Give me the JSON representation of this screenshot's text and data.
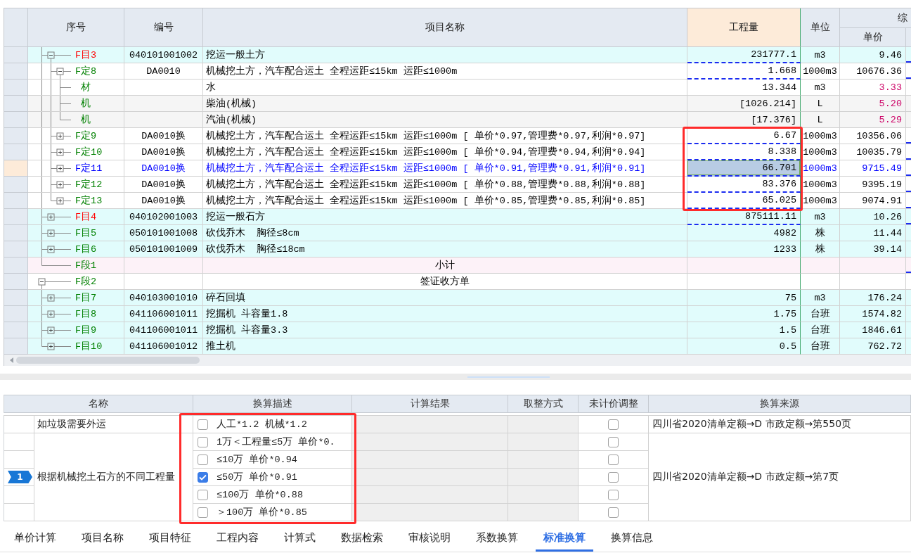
{
  "quota_table": {
    "columns": [
      {
        "label": "序号",
        "selected": false
      },
      {
        "label": "编号",
        "selected": false
      },
      {
        "label": "项目名称",
        "selected": false
      },
      {
        "label": "工程量",
        "selected": true
      },
      {
        "label": "单位",
        "selected": false
      }
    ],
    "column_group": {
      "label": "综",
      "columns": [
        {
          "label": "单价",
          "selected": false
        }
      ]
    },
    "rows": [
      {
        "children": [
          {
            "kind": "item",
            "seq": "F目3",
            "code": "040101001002",
            "name": "挖运一般土方",
            "quantity": "231777.1",
            "unit": "m3",
            "unit_price": "9.46",
            "color": "#ff0000",
            "expanded": true,
            "selected": false,
            "framed": false,
            "quantity_underline": true,
            "column_8_underline": true,
            "children": [
              {
                "kind": "quota",
                "seq": "F定8",
                "code": "DA0010",
                "name": "机械挖土方，汽车配合运土 全程运距≤15km 运距≤1000m",
                "quantity": "1.668",
                "unit": "1000m3",
                "unit_price": "10676.36",
                "color": "#008000",
                "expanded": true,
                "selected": false,
                "framed": false,
                "quantity_underline": true,
                "column_8_underline": true,
                "children": [
                  {
                    "kind": "material",
                    "seq": "材",
                    "name": "水",
                    "quantity": "13.344",
                    "unit": "m3",
                    "unit_price": {
                      "text": "3.33",
                      "color": "#cc0066"
                    },
                    "color": "#008000",
                    "selected": false,
                    "framed": false,
                    "quantity_underline": false,
                    "column_8_underline": false
                  },
                  {
                    "kind": "machinery",
                    "seq": "机",
                    "name": "柴油(机械)",
                    "quantity": "[1026.214]",
                    "unit": "L",
                    "unit_price": {
                      "text": "5.20",
                      "color": "#cc0066"
                    },
                    "color": "#008000",
                    "selected": false,
                    "framed": false,
                    "quantity_underline": false,
                    "column_8_underline": false
                  },
                  {
                    "kind": "machinery",
                    "seq": "机",
                    "name": "汽油(机械)",
                    "quantity": "[17.376]",
                    "unit": "L",
                    "unit_price": {
                      "text": "5.29",
                      "color": "#cc0066"
                    },
                    "color": "#008000",
                    "selected": false,
                    "framed": false,
                    "quantity_underline": false,
                    "column_8_underline": false
                  }
                ]
              },
              {
                "kind": "quota",
                "seq": "F定9",
                "code": "DA0010换",
                "name": "机械挖土方，汽车配合运土 全程运距≤15km 运距≤1000m [ 单价*0.97,管理费*0.97,利润*0.97]",
                "quantity": "6.67",
                "unit": "1000m3",
                "unit_price": "10356.06",
                "color": "#008000",
                "expanded": false,
                "selected": false,
                "framed": true,
                "quantity_underline": true,
                "column_8_underline": true
              },
              {
                "kind": "quota",
                "seq": "F定10",
                "code": "DA0010换",
                "name": "机械挖土方，汽车配合运土 全程运距≤15km 运距≤1000m [ 单价*0.94,管理费*0.94,利润*0.94]",
                "quantity": "8.338",
                "unit": "1000m3",
                "unit_price": "10035.79",
                "color": "#008000",
                "expanded": false,
                "selected": false,
                "framed": true,
                "quantity_underline": true,
                "column_8_underline": true
              },
              {
                "kind": "quota",
                "seq": "F定11",
                "code": "DA0010换",
                "name": "机械挖土方，汽车配合运土 全程运距≤15km 运距≤1000m [ 单价*0.91,管理费*0.91,利润*0.91]",
                "quantity": "66.701",
                "unit": "1000m3",
                "unit_price": "9715.49",
                "expanded": false,
                "selected": true,
                "framed": true,
                "quantity_underline": true,
                "column_8_underline": true
              },
              {
                "kind": "quota",
                "seq": "F定12",
                "code": "DA0010换",
                "name": "机械挖土方，汽车配合运土 全程运距≤15km 运距≤1000m [ 单价*0.88,管理费*0.88,利润*0.88]",
                "quantity": "83.376",
                "unit": "1000m3",
                "unit_price": "9395.19",
                "color": "#008000",
                "expanded": false,
                "selected": false,
                "framed": true,
                "quantity_underline": true,
                "column_8_underline": true
              },
              {
                "kind": "quota",
                "seq": "F定13",
                "code": "DA0010换",
                "name": "机械挖土方，汽车配合运土 全程运距≤15km 运距≤1000m [ 单价*0.85,管理费*0.85,利润*0.85]",
                "quantity": "65.025",
                "unit": "1000m3",
                "unit_price": "9074.91",
                "color": "#008000",
                "expanded": false,
                "selected": false,
                "framed": true,
                "quantity_underline": true,
                "column_8_underline": true
              }
            ]
          },
          {
            "kind": "item",
            "seq": "F目4",
            "code": "040102001003",
            "name": "挖运一般石方",
            "quantity": "875111.11",
            "unit": "m3",
            "unit_price": "10.26",
            "color": "#ff0000",
            "expanded": false,
            "selected": false,
            "framed": false,
            "quantity_underline": true,
            "column_8_underline": true
          },
          {
            "kind": "item",
            "seq": "F目5",
            "code": "050101001008",
            "name": "砍伐乔木  胸径≤8cm",
            "quantity": "4982",
            "unit": "株",
            "unit_price": "11.44",
            "color": "#008000",
            "expanded": false,
            "selected": false,
            "framed": false,
            "quantity_underline": false,
            "column_8_underline": false
          },
          {
            "kind": "item",
            "seq": "F目6",
            "code": "050101001009",
            "name": "砍伐乔木  胸径≤18cm",
            "quantity": "1233",
            "unit": "株",
            "unit_price": "39.14",
            "color": "#008000",
            "expanded": false,
            "selected": false,
            "framed": false,
            "quantity_underline": false,
            "column_8_underline": false
          },
          {
            "kind": "subtotal",
            "seq": "F段1",
            "name": "小计",
            "color": "#008000",
            "selected": false,
            "framed": false,
            "quantity_underline": false,
            "column_8_underline": true
          }
        ]
      },
      {
        "kind": "section",
        "seq": "F段2",
        "name": "签证收方单",
        "color": "#008000",
        "expanded": true,
        "selected": false,
        "framed": false,
        "quantity_underline": false,
        "column_8_underline": false,
        "children": [
          {
            "kind": "item",
            "seq": "F目7",
            "code": "040103001010",
            "name": "碎石回填",
            "quantity": "75",
            "unit": "m3",
            "unit_price": "176.24",
            "color": "#008000",
            "expanded": false,
            "selected": false,
            "framed": false,
            "quantity_underline": false,
            "column_8_underline": false
          },
          {
            "kind": "item",
            "seq": "F目8",
            "code": "041106001011",
            "name": "挖掘机 斗容量1.8",
            "quantity": "1.75",
            "unit": "台班",
            "unit_price": "1574.82",
            "color": "#008000",
            "expanded": false,
            "selected": false,
            "framed": false,
            "quantity_underline": false,
            "column_8_underline": false
          },
          {
            "kind": "item",
            "seq": "F目9",
            "code": "041106001011",
            "name": "挖掘机 斗容量3.3",
            "quantity": "1.5",
            "unit": "台班",
            "unit_price": "1846.61",
            "color": "#008000",
            "expanded": false,
            "selected": false,
            "framed": false,
            "quantity_underline": false,
            "column_8_underline": false
          },
          {
            "kind": "item",
            "seq": "F目10",
            "code": "041106001012",
            "name": "推土机",
            "quantity": "0.5",
            "unit": "台班",
            "unit_price": "762.72",
            "color": "#008000",
            "expanded": false,
            "selected": false,
            "framed": false,
            "quantity_underline": false,
            "column_8_underline": false
          }
        ]
      }
    ]
  },
  "conversion_table": {
    "columns": [
      {
        "label": "名称",
        "framed": false,
        "disabled": false
      },
      {
        "label": "换算描述",
        "framed": true,
        "disabled": false
      },
      {
        "label": "计算结果",
        "framed": false,
        "disabled": true
      },
      {
        "label": "取整方式",
        "framed": false,
        "disabled": true
      },
      {
        "label": "未计价调整",
        "framed": false,
        "disabled": false
      },
      {
        "label": "换算来源",
        "framed": false,
        "disabled": false
      }
    ],
    "marker": "1",
    "groups": [
      {
        "name": "如垃圾需要外运",
        "source": "四川省2020清单定额→D 市政定额→第550页",
        "options": [
          {
            "description": "人工*1.2 机械*1.2",
            "checked": false,
            "unpriced_adjustment": false,
            "selected": false
          }
        ]
      },
      {
        "name": "根据机械挖土石方的不同工程量",
        "source": "四川省2020清单定额→D 市政定额→第7页",
        "options": [
          {
            "description": "1万＜工程量≤5万 单价*0.",
            "checked": false,
            "unpriced_adjustment": false,
            "selected": false
          },
          {
            "description": "≤10万 单价*0.94",
            "checked": false,
            "unpriced_adjustment": false,
            "selected": false
          },
          {
            "description": "≤50万 单价*0.91",
            "checked": true,
            "unpriced_adjustment": false,
            "selected": true
          },
          {
            "description": "≤100万 单价*0.88",
            "checked": false,
            "unpriced_adjustment": false,
            "selected": false
          },
          {
            "description": "＞100万 单价*0.85",
            "checked": false,
            "unpriced_adjustment": false,
            "selected": false
          }
        ]
      }
    ]
  },
  "tabs": [
    {
      "label": "单价计算",
      "selected": false
    },
    {
      "label": "项目名称",
      "selected": false
    },
    {
      "label": "项目特征",
      "selected": false
    },
    {
      "label": "工程内容",
      "selected": false
    },
    {
      "label": "计算式",
      "selected": false
    },
    {
      "label": "数据检索",
      "selected": false
    },
    {
      "label": "审核说明",
      "selected": false
    },
    {
      "label": "系数换算",
      "selected": false
    },
    {
      "label": "标准换算",
      "selected": true
    },
    {
      "label": "换算信息",
      "selected": false
    }
  ]
}
